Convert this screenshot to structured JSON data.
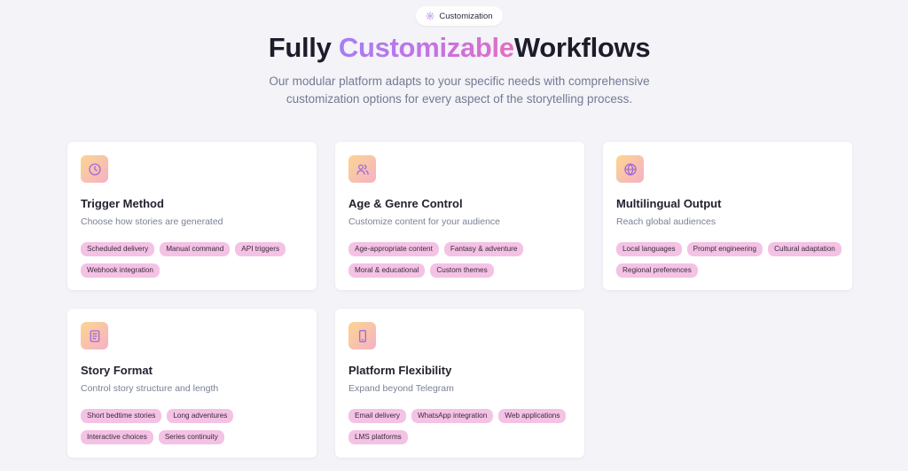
{
  "header": {
    "badge_label": "Customization",
    "title_part1": "Fully ",
    "title_accent": "Customizable",
    "title_part2": "Workflows",
    "subtitle": "Our modular platform adapts to your specific needs with comprehensive customization options for every aspect of the storytelling process."
  },
  "colors": {
    "accent_start": "#a77df3",
    "accent_end": "#e26fc2",
    "tag_bg": "#f4c2e5",
    "icon_gradient_start": "#fbd690",
    "icon_gradient_end": "#f6b0c6",
    "icon_stroke": "#a06ad8"
  },
  "cards": [
    {
      "icon": "clock-icon",
      "title": "Trigger Method",
      "description": "Choose how stories are generated",
      "tags": [
        "Scheduled delivery",
        "Manual command",
        "API triggers",
        "Webhook integration"
      ]
    },
    {
      "icon": "users-icon",
      "title": "Age & Genre Control",
      "description": "Customize content for your audience",
      "tags": [
        "Age-appropriate content",
        "Fantasy & adventure",
        "Moral & educational",
        "Custom themes"
      ]
    },
    {
      "icon": "globe-icon",
      "title": "Multilingual Output",
      "description": "Reach global audiences",
      "tags": [
        "Local languages",
        "Prompt engineering",
        "Cultural adaptation",
        "Regional preferences"
      ]
    },
    {
      "icon": "book-icon",
      "title": "Story Format",
      "description": "Control story structure and length",
      "tags": [
        "Short bedtime stories",
        "Long adventures",
        "Interactive choices",
        "Series continuity"
      ]
    },
    {
      "icon": "smartphone-icon",
      "title": "Platform Flexibility",
      "description": "Expand beyond Telegram",
      "tags": [
        "Email delivery",
        "WhatsApp integration",
        "Web applications",
        "LMS platforms"
      ]
    }
  ]
}
